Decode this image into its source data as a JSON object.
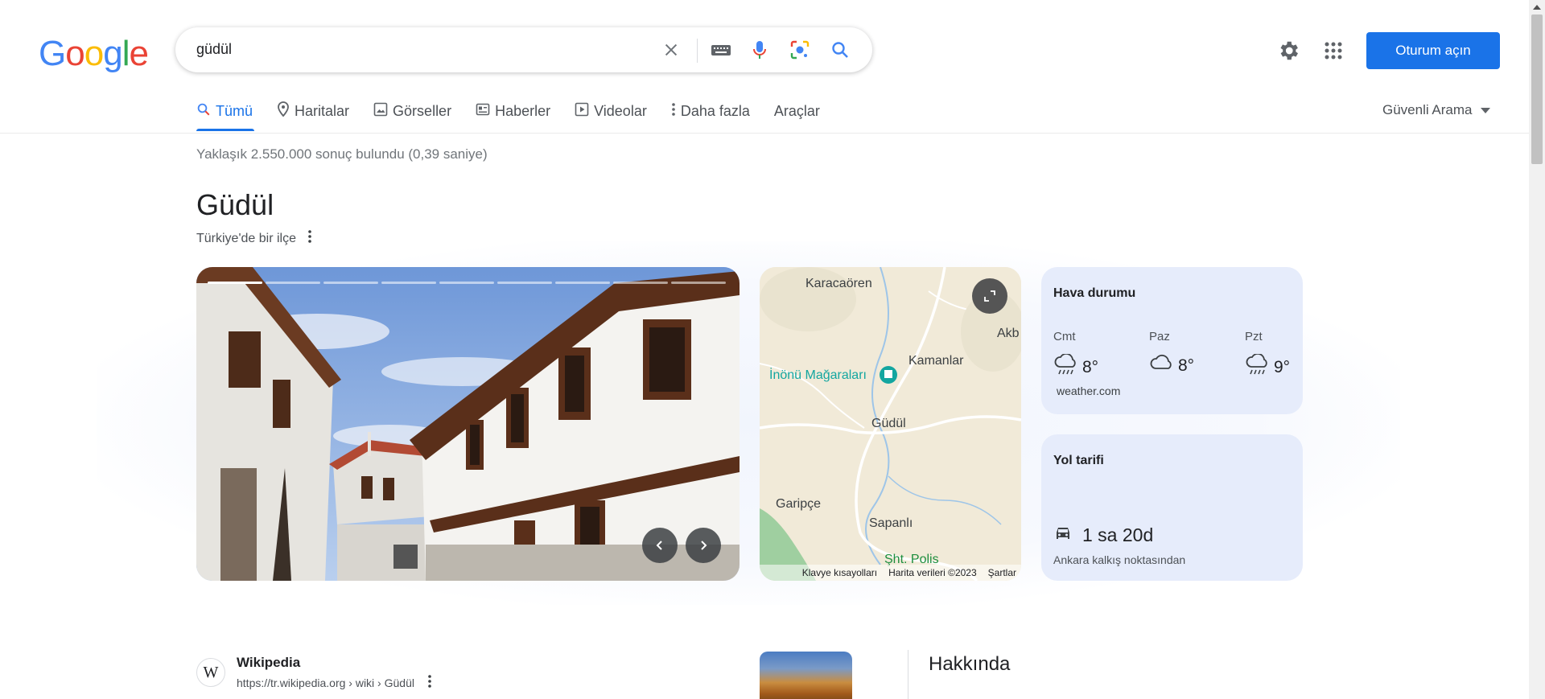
{
  "header": {
    "logo_letters": [
      "G",
      "o",
      "o",
      "g",
      "l",
      "e"
    ],
    "logo_colors": [
      "#4285f4",
      "#ea4335",
      "#fbbc05",
      "#4285f4",
      "#34a853",
      "#ea4335"
    ],
    "search_query": "güdül",
    "signin_label": "Oturum açın"
  },
  "tabs": {
    "items": [
      {
        "label": "Tümü",
        "icon": "search-icon"
      },
      {
        "label": "Haritalar",
        "icon": "map-pin-icon"
      },
      {
        "label": "Görseller",
        "icon": "image-icon"
      },
      {
        "label": "Haberler",
        "icon": "news-icon"
      },
      {
        "label": "Videolar",
        "icon": "video-icon"
      },
      {
        "label": "Daha fazla",
        "icon": "more-vert-icon"
      },
      {
        "label": "Araçlar",
        "icon": ""
      }
    ],
    "safe_search": "Güvenli Arama"
  },
  "stats": "Yaklaşık 2.550.000 sonuç bulundu (0,39 saniye)",
  "knowledge_panel": {
    "title": "Güdül",
    "subtitle": "Türkiye'de bir ilçe",
    "map": {
      "labels": [
        "Karacaören",
        "Akb",
        "Kamanlar",
        "İnönü Mağaraları",
        "Güdül",
        "Garipçe",
        "Sapanlı",
        "Şht. Polis"
      ],
      "footer": [
        "Klavye kısayolları",
        "Harita verileri ©2023",
        "Şartlar"
      ]
    },
    "weather": {
      "title": "Hava durumu",
      "days": [
        {
          "day": "Cmt",
          "temp": "8°",
          "icon": "rain-icon"
        },
        {
          "day": "Paz",
          "temp": "8°",
          "icon": "cloud-icon"
        },
        {
          "day": "Pzt",
          "temp": "9°",
          "icon": "rain-icon"
        }
      ],
      "source": "weather.com"
    },
    "route": {
      "title": "Yol tarifi",
      "duration": "1 sa 20d",
      "from": "Ankara kalkış noktasından"
    }
  },
  "result": {
    "site": "Wikipedia",
    "url": "https://tr.wikipedia.org › wiki › Güdül",
    "favicon_letter": "W"
  },
  "about": {
    "title": "Hakkında"
  }
}
